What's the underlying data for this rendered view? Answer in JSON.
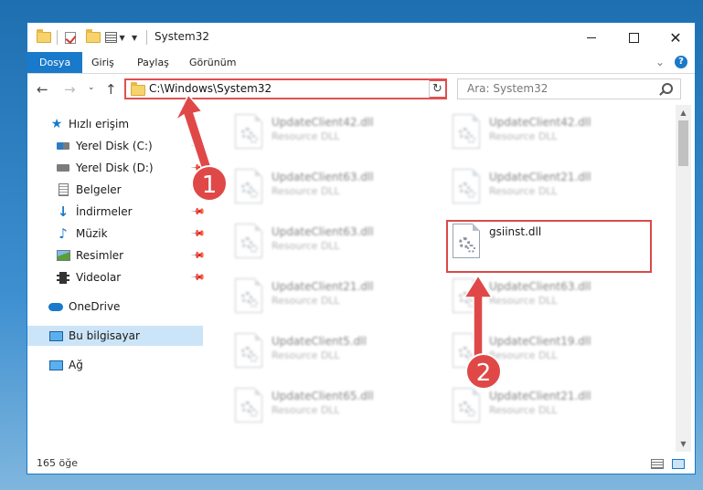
{
  "window": {
    "title": "System32"
  },
  "ribbon": {
    "tabs": [
      {
        "label": "Dosya",
        "active": true
      },
      {
        "label": "Giriş"
      },
      {
        "label": "Paylaş"
      },
      {
        "label": "Görünüm"
      }
    ]
  },
  "nav": {
    "address": "C:\\Windows\\System32",
    "search_placeholder": "Ara: System32"
  },
  "sidebar": {
    "items": [
      {
        "label": "Hızlı erişim",
        "icon": "star-icon"
      },
      {
        "label": "Yerel Disk (C:)",
        "icon": "disk-icon",
        "pinned": true
      },
      {
        "label": "Yerel Disk (D:)",
        "icon": "disk-icon",
        "pinned": true
      },
      {
        "label": "Belgeler",
        "icon": "document-icon",
        "pinned": true
      },
      {
        "label": "İndirmeler",
        "icon": "download-icon",
        "pinned": true
      },
      {
        "label": "Müzik",
        "icon": "music-icon",
        "pinned": true
      },
      {
        "label": "Resimler",
        "icon": "pictures-icon",
        "pinned": true
      },
      {
        "label": "Videolar",
        "icon": "video-icon",
        "pinned": true
      },
      {
        "label": "OneDrive",
        "icon": "cloud-icon"
      },
      {
        "label": "Bu bilgisayar",
        "icon": "computer-icon",
        "selected": true
      },
      {
        "label": "Ağ",
        "icon": "network-icon"
      }
    ]
  },
  "files": [
    {
      "name": "UpdateClient42.dll",
      "desc": "Resource DLL"
    },
    {
      "name": "UpdateClient42.dll",
      "desc": "Resource DLL"
    },
    {
      "name": "UpdateClient63.dll",
      "desc": "Resource DLL"
    },
    {
      "name": "UpdateClient21.dll",
      "desc": "Resource DLL"
    },
    {
      "name": "UpdateClient63.dll",
      "desc": "Resource DLL"
    },
    {
      "name": "gsiinst.dll",
      "desc": "",
      "highlighted": true
    },
    {
      "name": "UpdateClient21.dll",
      "desc": "Resource DLL"
    },
    {
      "name": "UpdateClient63.dll",
      "desc": "Resource DLL"
    },
    {
      "name": "UpdateClient5.dll",
      "desc": "Resource DLL"
    },
    {
      "name": "UpdateClient19.dll",
      "desc": "Resource DLL"
    },
    {
      "name": "UpdateClient65.dll",
      "desc": "Resource DLL"
    },
    {
      "name": "UpdateClient21.dll",
      "desc": "Resource DLL"
    }
  ],
  "status": {
    "item_count": "165 öğe"
  },
  "annotations": {
    "step1": "1",
    "step2": "2"
  },
  "colors": {
    "accent": "#1979ca",
    "annotation": "#e04848"
  }
}
